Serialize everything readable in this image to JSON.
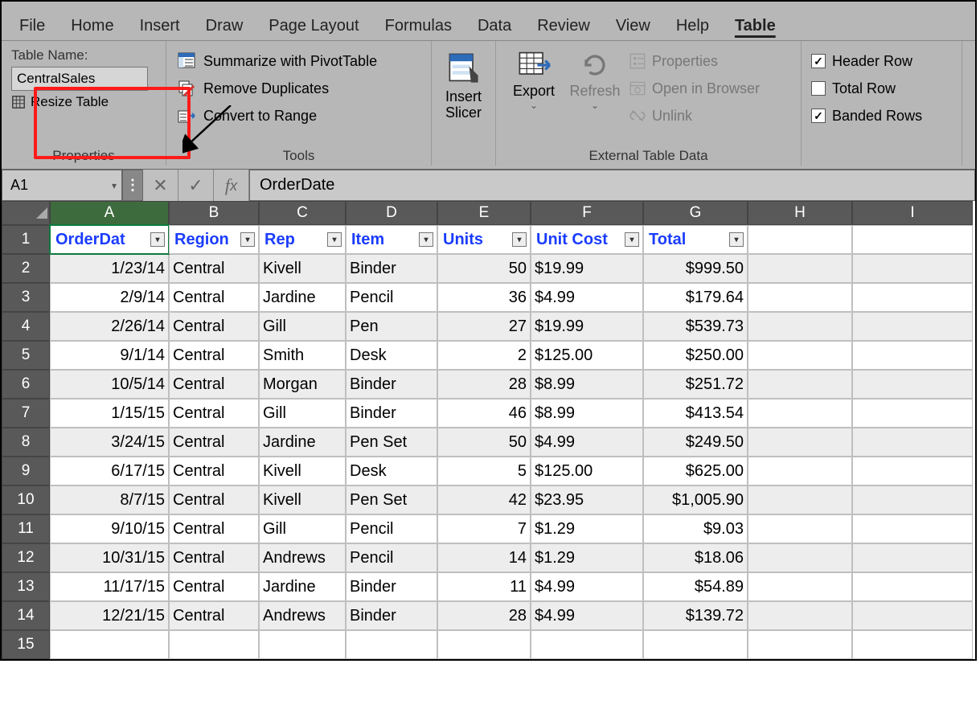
{
  "tabs": [
    "File",
    "Home",
    "Insert",
    "Draw",
    "Page Layout",
    "Formulas",
    "Data",
    "Review",
    "View",
    "Help",
    "Table"
  ],
  "active_tab_index": 10,
  "ribbon": {
    "properties": {
      "label": "Properties",
      "table_name_label": "Table Name:",
      "table_name_value": "CentralSales",
      "resize_label": "Resize Table"
    },
    "tools": {
      "label": "Tools",
      "pivot": "Summarize with PivotTable",
      "dup": "Remove Duplicates",
      "range": "Convert to Range"
    },
    "slicer": {
      "line1": "Insert",
      "line2": "Slicer"
    },
    "external": {
      "label": "External Table Data",
      "export": "Export",
      "refresh": "Refresh",
      "props": "Properties",
      "browser": "Open in Browser",
      "unlink": "Unlink"
    },
    "tso": {
      "header": "Header Row",
      "total": "Total Row",
      "banded": "Banded Rows"
    }
  },
  "formula_bar": {
    "name_box": "A1",
    "value": "OrderDate"
  },
  "columns": [
    "A",
    "B",
    "C",
    "D",
    "E",
    "F",
    "G",
    "H",
    "I"
  ],
  "table_headers": [
    "OrderDat",
    "Region",
    "Rep",
    "Item",
    "Units",
    "Unit Cost",
    "Total"
  ],
  "chart_data": {
    "type": "table",
    "columns": [
      "OrderDate",
      "Region",
      "Rep",
      "Item",
      "Units",
      "Unit Cost",
      "Total"
    ],
    "rows": [
      [
        "1/23/14",
        "Central",
        "Kivell",
        "Binder",
        50,
        "$19.99",
        "$999.50"
      ],
      [
        "2/9/14",
        "Central",
        "Jardine",
        "Pencil",
        36,
        "$4.99",
        "$179.64"
      ],
      [
        "2/26/14",
        "Central",
        "Gill",
        "Pen",
        27,
        "$19.99",
        "$539.73"
      ],
      [
        "9/1/14",
        "Central",
        "Smith",
        "Desk",
        2,
        "$125.00",
        "$250.00"
      ],
      [
        "10/5/14",
        "Central",
        "Morgan",
        "Binder",
        28,
        "$8.99",
        "$251.72"
      ],
      [
        "1/15/15",
        "Central",
        "Gill",
        "Binder",
        46,
        "$8.99",
        "$413.54"
      ],
      [
        "3/24/15",
        "Central",
        "Jardine",
        "Pen Set",
        50,
        "$4.99",
        "$249.50"
      ],
      [
        "6/17/15",
        "Central",
        "Kivell",
        "Desk",
        5,
        "$125.00",
        "$625.00"
      ],
      [
        "8/7/15",
        "Central",
        "Kivell",
        "Pen Set",
        42,
        "$23.95",
        "$1,005.90"
      ],
      [
        "9/10/15",
        "Central",
        "Gill",
        "Pencil",
        7,
        "$1.29",
        "$9.03"
      ],
      [
        "10/31/15",
        "Central",
        "Andrews",
        "Pencil",
        14,
        "$1.29",
        "$18.06"
      ],
      [
        "11/17/15",
        "Central",
        "Jardine",
        "Binder",
        11,
        "$4.99",
        "$54.89"
      ],
      [
        "12/21/15",
        "Central",
        "Andrews",
        "Binder",
        28,
        "$4.99",
        "$139.72"
      ]
    ]
  }
}
